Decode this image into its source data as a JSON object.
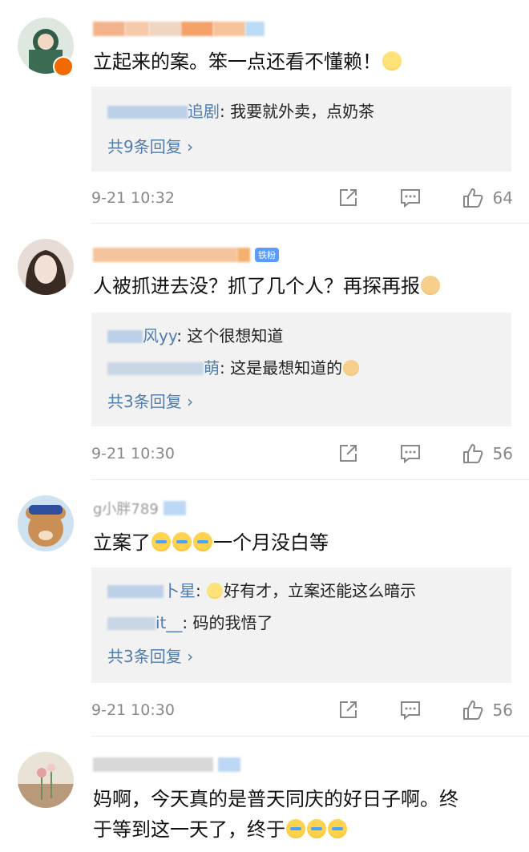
{
  "comments": [
    {
      "text": "立起来的案。笨一点还看不懂赖！",
      "replies": [
        {
          "name": "追剧",
          "sep": ": ",
          "text": "我要就外卖，点奶茶"
        }
      ],
      "more": "共9条回复 ›",
      "time": "9-21 10:32",
      "likes": "64"
    },
    {
      "text": "人被抓进去没？抓了几个人？再探再报",
      "badge": "铁粉",
      "replies": [
        {
          "name": "风yy",
          "sep": ": ",
          "text": "这个很想知道"
        },
        {
          "name": "萌",
          "sep": ": ",
          "text": "这是最想知道的"
        }
      ],
      "more": "共3条回复 ›",
      "time": "9-21 10:30",
      "likes": "56"
    },
    {
      "username_visible": "g小胖789",
      "text_before": "立案了",
      "text_after": "一个月没白等",
      "replies": [
        {
          "name": "卜星",
          "sep": ": ",
          "text": "好有才，立案还能这么暗示"
        },
        {
          "name": "it__",
          "sep": ": ",
          "text": "码的我悟了"
        }
      ],
      "more": "共3条回复 ›",
      "time": "9-21 10:30",
      "likes": "56"
    },
    {
      "text_line1": "妈啊，今天真的是普天同庆的好日子啊。终",
      "text_line2": "于等到这一天了，终于"
    }
  ]
}
